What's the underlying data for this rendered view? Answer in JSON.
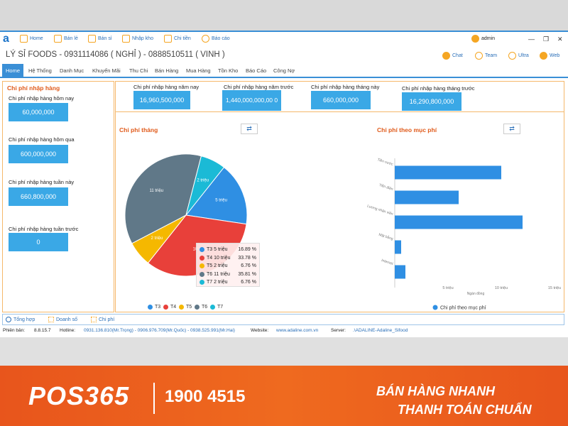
{
  "toolbar": {
    "items": [
      {
        "label": "Home",
        "icon": "home-icon",
        "color": "#f5a623"
      },
      {
        "label": "Bán lẻ",
        "icon": "cart-icon",
        "color": "#f5a623"
      },
      {
        "label": "Bán sỉ",
        "icon": "cart-icon",
        "color": "#f5a623"
      },
      {
        "label": "Nhập kho",
        "icon": "box-icon",
        "color": "#f5a623"
      },
      {
        "label": "Chi tiền",
        "icon": "money-icon",
        "color": "#f5a623"
      },
      {
        "label": "Báo cáo",
        "icon": "report-icon",
        "color": "#f5a623"
      }
    ],
    "user": "admin"
  },
  "window": {
    "title": "LÝ SỈ FOODS - 0931114086 ( NGHỈ ) - 0888510511 ( VINH )",
    "minimize": "—",
    "restore": "❐",
    "close": "✕"
  },
  "right_tools": [
    {
      "label": "Chat"
    },
    {
      "label": "Team"
    },
    {
      "label": "Ultra"
    },
    {
      "label": "Web"
    }
  ],
  "menu": [
    "Home",
    "Hệ Thống",
    "Danh Mục",
    "Khuyến Mãi",
    "Thu Chi",
    "Bán Hàng",
    "Mua Hàng",
    "Tồn Kho",
    "Báo Cáo",
    "Công Nợ"
  ],
  "left_panel": {
    "title": "Chi phí nhập hàng",
    "items": [
      {
        "label": "Chi phí nhập hàng hôm nay",
        "value": "60,000,000"
      },
      {
        "label": "Chi phí nhập hàng hôm qua",
        "value": "600,000,000"
      },
      {
        "label": "Chi phí nhập hàng tuần này",
        "value": "660,800,000"
      },
      {
        "label": "Chi phí nhập hàng tuần trước",
        "value": "0"
      }
    ]
  },
  "top_stats": [
    {
      "label": "Chi phí nhập hàng năm nay",
      "value": "16,960,500,000"
    },
    {
      "label": "Chi phí nhập hàng năm trước",
      "value": "1,440,000,000,00 0"
    },
    {
      "label": "Chi phí nhập hàng tháng này",
      "value": "660,000,000"
    },
    {
      "label": "Chi phí nhập hàng tháng trước",
      "value": "16,290,800,000"
    }
  ],
  "refresh_icon": "⇄",
  "chart_data": [
    {
      "type": "pie",
      "title": "Chi phí tháng",
      "categories": [
        "T3",
        "T4",
        "T5",
        "T6",
        "T7"
      ],
      "values": [
        5,
        10,
        2,
        11,
        2
      ],
      "slice_labels": [
        "5 triệu",
        "10 triệu",
        "2 triệu",
        "11 triệu",
        "2 triệu"
      ],
      "percents": [
        "16.89 %",
        "33.78 %",
        "6.76 %",
        "35.81 %",
        "6.76 %"
      ],
      "tooltip_labels": [
        "T3 5 triệu",
        "T4 10 triệu",
        "T5 2 triệu",
        "T6 11 triệu",
        "T7 2 triệu"
      ],
      "colors": [
        "#2f8fe3",
        "#e8403a",
        "#f5b800",
        "#607888",
        "#1bbad6"
      ],
      "legend": "bottom"
    },
    {
      "type": "bar",
      "orientation": "horizontal",
      "title": "Chi phí theo mục phí",
      "categories": [
        "Tiền nước",
        "Tiền điện",
        "Lương nhân viên",
        "Mặt bằng",
        "Internet"
      ],
      "values": [
        10,
        6,
        12,
        0.6,
        1
      ],
      "ticks": [
        "5 triệu",
        "10 triệu",
        "15 triệu"
      ],
      "tick_values": [
        5,
        10,
        15
      ],
      "xlim": [
        0,
        15
      ],
      "xlabel": "Ngàn đồng",
      "series_name": "Chi phí theo mục phí",
      "color": "#2f8fe3",
      "legend": "bottom"
    }
  ],
  "bottom_tabs": [
    {
      "label": "Tổng hợp"
    },
    {
      "label": "Doanh số"
    },
    {
      "label": "Chi phí"
    }
  ],
  "status": {
    "version_label": "Phiên bản:",
    "version": "8.8.15.7",
    "hotline_label": "Hotline:",
    "hotline": "0931.136.810(Mr.Trọng) - 0906.976.709(Mr.Quốc) - 0938.525.991(Mr.Hai)",
    "website_label": "Website:",
    "website": "www.adaline.com.vn",
    "server_label": "Server:",
    "server": ".\\ADALINE-Adaline_Sifood"
  },
  "banner": {
    "brand": "POS365",
    "phone": "1900 4515",
    "slogan1": "BÁN HÀNG NHANH",
    "slogan2": "THANH TOÁN CHUẨN"
  }
}
